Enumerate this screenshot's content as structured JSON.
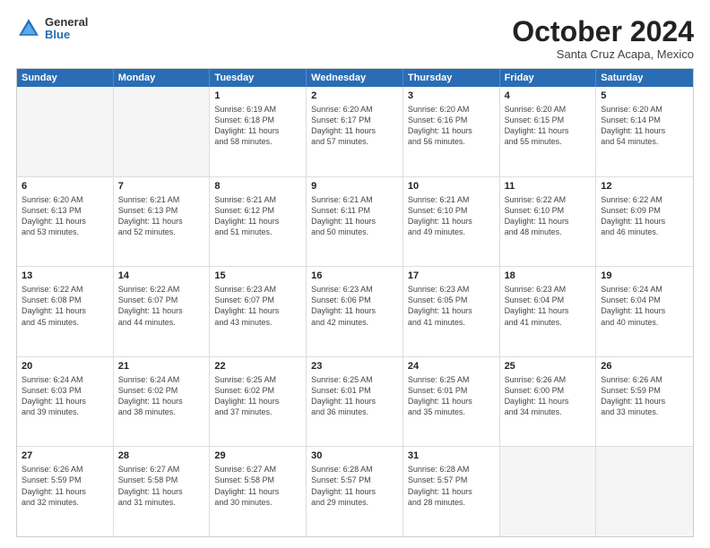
{
  "logo": {
    "general": "General",
    "blue": "Blue"
  },
  "title": "October 2024",
  "subtitle": "Santa Cruz Acapa, Mexico",
  "header_days": [
    "Sunday",
    "Monday",
    "Tuesday",
    "Wednesday",
    "Thursday",
    "Friday",
    "Saturday"
  ],
  "weeks": [
    [
      {
        "day": "",
        "lines": [],
        "empty": true
      },
      {
        "day": "",
        "lines": [],
        "empty": true
      },
      {
        "day": "1",
        "lines": [
          "Sunrise: 6:19 AM",
          "Sunset: 6:18 PM",
          "Daylight: 11 hours",
          "and 58 minutes."
        ]
      },
      {
        "day": "2",
        "lines": [
          "Sunrise: 6:20 AM",
          "Sunset: 6:17 PM",
          "Daylight: 11 hours",
          "and 57 minutes."
        ]
      },
      {
        "day": "3",
        "lines": [
          "Sunrise: 6:20 AM",
          "Sunset: 6:16 PM",
          "Daylight: 11 hours",
          "and 56 minutes."
        ]
      },
      {
        "day": "4",
        "lines": [
          "Sunrise: 6:20 AM",
          "Sunset: 6:15 PM",
          "Daylight: 11 hours",
          "and 55 minutes."
        ]
      },
      {
        "day": "5",
        "lines": [
          "Sunrise: 6:20 AM",
          "Sunset: 6:14 PM",
          "Daylight: 11 hours",
          "and 54 minutes."
        ]
      }
    ],
    [
      {
        "day": "6",
        "lines": [
          "Sunrise: 6:20 AM",
          "Sunset: 6:13 PM",
          "Daylight: 11 hours",
          "and 53 minutes."
        ]
      },
      {
        "day": "7",
        "lines": [
          "Sunrise: 6:21 AM",
          "Sunset: 6:13 PM",
          "Daylight: 11 hours",
          "and 52 minutes."
        ]
      },
      {
        "day": "8",
        "lines": [
          "Sunrise: 6:21 AM",
          "Sunset: 6:12 PM",
          "Daylight: 11 hours",
          "and 51 minutes."
        ]
      },
      {
        "day": "9",
        "lines": [
          "Sunrise: 6:21 AM",
          "Sunset: 6:11 PM",
          "Daylight: 11 hours",
          "and 50 minutes."
        ]
      },
      {
        "day": "10",
        "lines": [
          "Sunrise: 6:21 AM",
          "Sunset: 6:10 PM",
          "Daylight: 11 hours",
          "and 49 minutes."
        ]
      },
      {
        "day": "11",
        "lines": [
          "Sunrise: 6:22 AM",
          "Sunset: 6:10 PM",
          "Daylight: 11 hours",
          "and 48 minutes."
        ]
      },
      {
        "day": "12",
        "lines": [
          "Sunrise: 6:22 AM",
          "Sunset: 6:09 PM",
          "Daylight: 11 hours",
          "and 46 minutes."
        ]
      }
    ],
    [
      {
        "day": "13",
        "lines": [
          "Sunrise: 6:22 AM",
          "Sunset: 6:08 PM",
          "Daylight: 11 hours",
          "and 45 minutes."
        ]
      },
      {
        "day": "14",
        "lines": [
          "Sunrise: 6:22 AM",
          "Sunset: 6:07 PM",
          "Daylight: 11 hours",
          "and 44 minutes."
        ]
      },
      {
        "day": "15",
        "lines": [
          "Sunrise: 6:23 AM",
          "Sunset: 6:07 PM",
          "Daylight: 11 hours",
          "and 43 minutes."
        ]
      },
      {
        "day": "16",
        "lines": [
          "Sunrise: 6:23 AM",
          "Sunset: 6:06 PM",
          "Daylight: 11 hours",
          "and 42 minutes."
        ]
      },
      {
        "day": "17",
        "lines": [
          "Sunrise: 6:23 AM",
          "Sunset: 6:05 PM",
          "Daylight: 11 hours",
          "and 41 minutes."
        ]
      },
      {
        "day": "18",
        "lines": [
          "Sunrise: 6:23 AM",
          "Sunset: 6:04 PM",
          "Daylight: 11 hours",
          "and 41 minutes."
        ]
      },
      {
        "day": "19",
        "lines": [
          "Sunrise: 6:24 AM",
          "Sunset: 6:04 PM",
          "Daylight: 11 hours",
          "and 40 minutes."
        ]
      }
    ],
    [
      {
        "day": "20",
        "lines": [
          "Sunrise: 6:24 AM",
          "Sunset: 6:03 PM",
          "Daylight: 11 hours",
          "and 39 minutes."
        ]
      },
      {
        "day": "21",
        "lines": [
          "Sunrise: 6:24 AM",
          "Sunset: 6:02 PM",
          "Daylight: 11 hours",
          "and 38 minutes."
        ]
      },
      {
        "day": "22",
        "lines": [
          "Sunrise: 6:25 AM",
          "Sunset: 6:02 PM",
          "Daylight: 11 hours",
          "and 37 minutes."
        ]
      },
      {
        "day": "23",
        "lines": [
          "Sunrise: 6:25 AM",
          "Sunset: 6:01 PM",
          "Daylight: 11 hours",
          "and 36 minutes."
        ]
      },
      {
        "day": "24",
        "lines": [
          "Sunrise: 6:25 AM",
          "Sunset: 6:01 PM",
          "Daylight: 11 hours",
          "and 35 minutes."
        ]
      },
      {
        "day": "25",
        "lines": [
          "Sunrise: 6:26 AM",
          "Sunset: 6:00 PM",
          "Daylight: 11 hours",
          "and 34 minutes."
        ]
      },
      {
        "day": "26",
        "lines": [
          "Sunrise: 6:26 AM",
          "Sunset: 5:59 PM",
          "Daylight: 11 hours",
          "and 33 minutes."
        ]
      }
    ],
    [
      {
        "day": "27",
        "lines": [
          "Sunrise: 6:26 AM",
          "Sunset: 5:59 PM",
          "Daylight: 11 hours",
          "and 32 minutes."
        ]
      },
      {
        "day": "28",
        "lines": [
          "Sunrise: 6:27 AM",
          "Sunset: 5:58 PM",
          "Daylight: 11 hours",
          "and 31 minutes."
        ]
      },
      {
        "day": "29",
        "lines": [
          "Sunrise: 6:27 AM",
          "Sunset: 5:58 PM",
          "Daylight: 11 hours",
          "and 30 minutes."
        ]
      },
      {
        "day": "30",
        "lines": [
          "Sunrise: 6:28 AM",
          "Sunset: 5:57 PM",
          "Daylight: 11 hours",
          "and 29 minutes."
        ]
      },
      {
        "day": "31",
        "lines": [
          "Sunrise: 6:28 AM",
          "Sunset: 5:57 PM",
          "Daylight: 11 hours",
          "and 28 minutes."
        ]
      },
      {
        "day": "",
        "lines": [],
        "empty": true
      },
      {
        "day": "",
        "lines": [],
        "empty": true
      }
    ]
  ]
}
